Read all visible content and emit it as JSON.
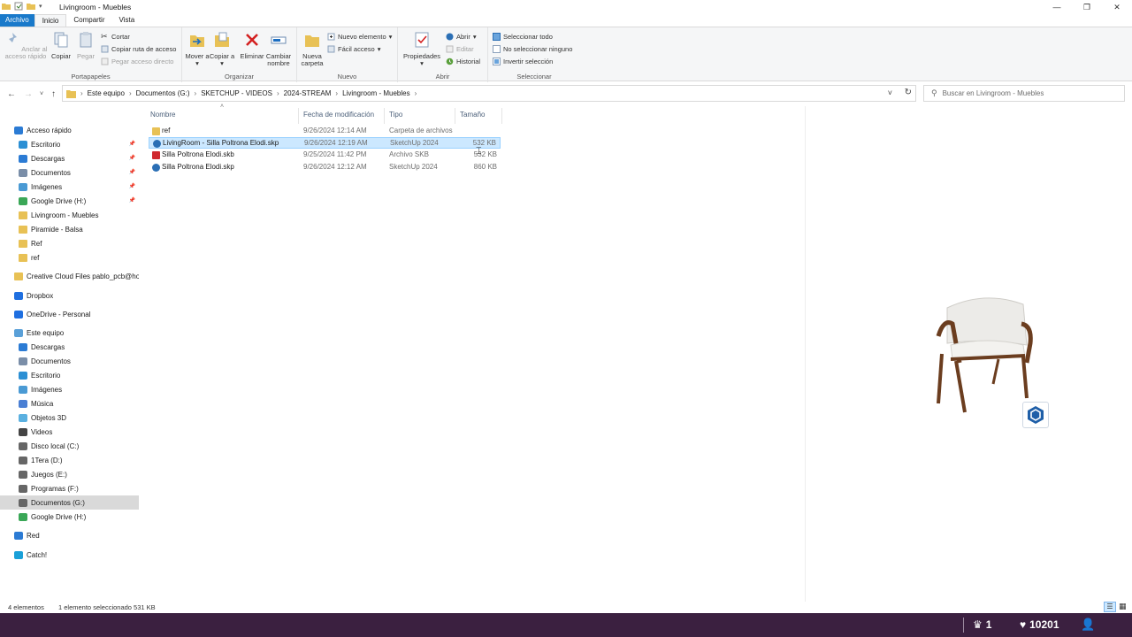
{
  "window": {
    "title": "Livingroom - Muebles",
    "controls": [
      "—",
      "❐",
      "✕"
    ]
  },
  "ribbon_tabs": [
    "Archivo",
    "Inicio",
    "Compartir",
    "Vista"
  ],
  "ribbon": {
    "portapapeles": {
      "label": "Portapapeles",
      "anclar": "Anclar al acceso rápido",
      "copiar": "Copiar",
      "pegar": "Pegar",
      "cortar": "Cortar",
      "copiar_ruta": "Copiar ruta de acceso",
      "pegar_acceso": "Pegar acceso directo"
    },
    "organizar": {
      "label": "Organizar",
      "mover": "Mover a",
      "copiar": "Copiar a",
      "eliminar": "Eliminar",
      "cambiar": "Cambiar nombre"
    },
    "nuevo": {
      "label": "Nuevo",
      "nueva_carpeta": "Nueva carpeta",
      "nuevo_elemento": "Nuevo elemento",
      "facil_acceso": "Fácil acceso"
    },
    "abrir": {
      "label": "Abrir",
      "propiedades": "Propiedades",
      "abrir": "Abrir",
      "editar": "Editar",
      "historial": "Historial"
    },
    "seleccionar": {
      "label": "Seleccionar",
      "todo": "Seleccionar todo",
      "ninguno": "No seleccionar ninguno",
      "invertir": "Invertir selección"
    }
  },
  "breadcrumb": [
    "Este equipo",
    "Documentos (G:)",
    "SKETCHUP - VIDEOS",
    "2024-STREAM",
    "Livingroom - Muebles"
  ],
  "search": {
    "placeholder": "Buscar en Livingroom - Muebles"
  },
  "nav": [
    {
      "label": "Acceso rápido",
      "icon": "star-icon",
      "indent": 0,
      "pin": false
    },
    {
      "label": "Escritorio",
      "icon": "desktop-icon",
      "indent": 1,
      "pin": true
    },
    {
      "label": "Descargas",
      "icon": "download-icon",
      "indent": 1,
      "pin": true
    },
    {
      "label": "Documentos",
      "icon": "documents-icon",
      "indent": 1,
      "pin": true
    },
    {
      "label": "Imágenes",
      "icon": "pictures-icon",
      "indent": 1,
      "pin": true
    },
    {
      "label": "Google Drive (H:)",
      "icon": "google-drive-icon",
      "indent": 1,
      "pin": true
    },
    {
      "label": "Livingroom - Muebles",
      "icon": "folder-icon",
      "indent": 1,
      "pin": false
    },
    {
      "label": "Piramide - Balsa",
      "icon": "folder-icon",
      "indent": 1,
      "pin": false
    },
    {
      "label": "Ref",
      "icon": "folder-icon",
      "indent": 1,
      "pin": false
    },
    {
      "label": "ref",
      "icon": "folder-icon",
      "indent": 1,
      "pin": false
    },
    {
      "label": "Creative Cloud Files  pablo_pcb@ho",
      "icon": "folder-icon",
      "indent": 0,
      "pin": false
    },
    {
      "label": "Dropbox",
      "icon": "dropbox-icon",
      "indent": 0,
      "pin": false
    },
    {
      "label": "OneDrive - Personal",
      "icon": "onedrive-icon",
      "indent": 0,
      "pin": false
    },
    {
      "label": "Este equipo",
      "icon": "computer-icon",
      "indent": 0,
      "pin": false
    },
    {
      "label": "Descargas",
      "icon": "download-icon",
      "indent": 1,
      "pin": false
    },
    {
      "label": "Documentos",
      "icon": "documents-icon",
      "indent": 1,
      "pin": false
    },
    {
      "label": "Escritorio",
      "icon": "desktop-icon",
      "indent": 1,
      "pin": false
    },
    {
      "label": "Imágenes",
      "icon": "pictures-icon",
      "indent": 1,
      "pin": false
    },
    {
      "label": "Música",
      "icon": "music-icon",
      "indent": 1,
      "pin": false
    },
    {
      "label": "Objetos 3D",
      "icon": "objects-3d-icon",
      "indent": 1,
      "pin": false
    },
    {
      "label": "Videos",
      "icon": "videos-icon",
      "indent": 1,
      "pin": false
    },
    {
      "label": "Disco local (C:)",
      "icon": "drive-icon",
      "indent": 1,
      "pin": false
    },
    {
      "label": "1Tera (D:)",
      "icon": "drive-icon",
      "indent": 1,
      "pin": false
    },
    {
      "label": "Juegos (E:)",
      "icon": "drive-icon",
      "indent": 1,
      "pin": false
    },
    {
      "label": "Programas (F:)",
      "icon": "drive-icon",
      "indent": 1,
      "pin": false
    },
    {
      "label": "Documentos (G:)",
      "icon": "drive-icon",
      "indent": 1,
      "pin": false,
      "selected": true
    },
    {
      "label": "Google Drive (H:)",
      "icon": "google-drive-icon",
      "indent": 1,
      "pin": false
    },
    {
      "label": "Red",
      "icon": "network-icon",
      "indent": 0,
      "pin": false
    },
    {
      "label": "Catch!",
      "icon": "catch-icon",
      "indent": 0,
      "pin": false
    }
  ],
  "columns": [
    "Nombre",
    "Fecha de modificación",
    "Tipo",
    "Tamaño"
  ],
  "files": [
    {
      "name": "ref",
      "date": "9/26/2024 12:14 AM",
      "type": "Carpeta de archivos",
      "size": "",
      "icon": "folder-icon"
    },
    {
      "name": "LivingRoom - Silla Poltrona Elodi.skp",
      "date": "9/26/2024 12:19 AM",
      "type": "SketchUp 2024",
      "size": "532 KB",
      "icon": "sketchup-icon",
      "selected": true
    },
    {
      "name": "Silla Poltrona Elodi.skb",
      "date": "9/25/2024 11:42 PM",
      "type": "Archivo SKB",
      "size": "532 KB",
      "icon": "skb-icon"
    },
    {
      "name": "Silla Poltrona Elodi.skp",
      "date": "9/26/2024 12:12 AM",
      "type": "SketchUp 2024",
      "size": "860 KB",
      "icon": "sketchup-icon"
    }
  ],
  "status": {
    "count": "4 elementos",
    "selection": "1 elemento seleccionado  531 KB"
  },
  "taskbar": {
    "crown_count": "1",
    "heart_count": "10201"
  }
}
